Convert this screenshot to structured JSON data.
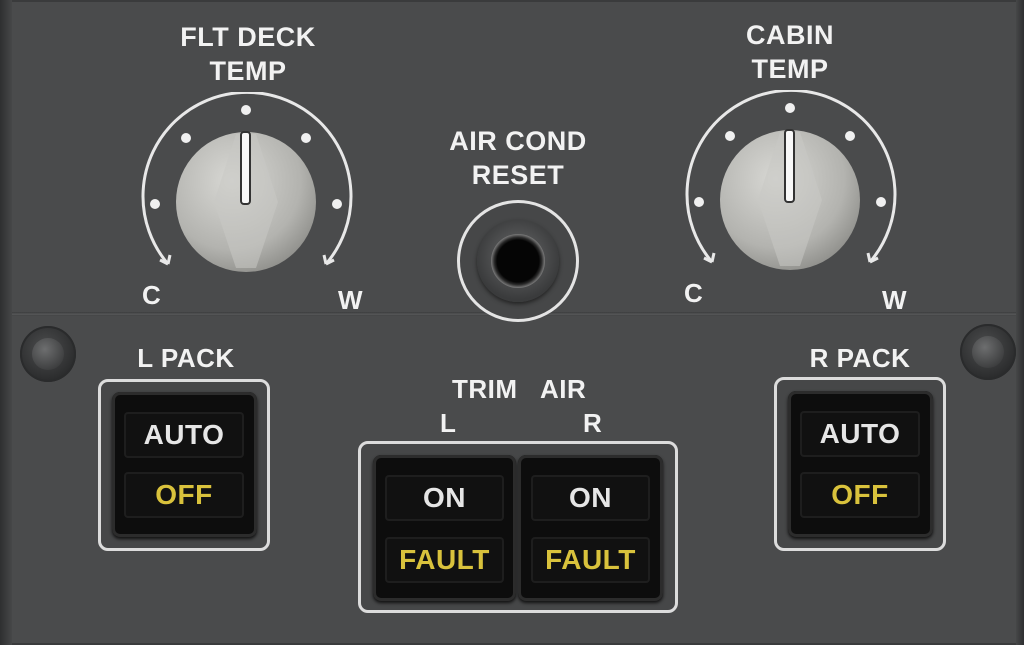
{
  "flt_deck_temp": {
    "label_line1": "FLT DECK",
    "label_line2": "TEMP",
    "cold_label": "C",
    "warm_label": "W"
  },
  "cabin_temp": {
    "label_line1": "CABIN",
    "label_line2": "TEMP",
    "cold_label": "C",
    "warm_label": "W"
  },
  "air_cond_reset": {
    "label_line1": "AIR COND",
    "label_line2": "RESET"
  },
  "l_pack": {
    "label": "L PACK",
    "upper_legend": "AUTO",
    "lower_legend": "OFF"
  },
  "r_pack": {
    "label": "R PACK",
    "upper_legend": "AUTO",
    "lower_legend": "OFF"
  },
  "trim_air": {
    "label_trim": "TRIM",
    "label_air": "AIR",
    "left_label": "L",
    "right_label": "R",
    "left_switch": {
      "upper_legend": "ON",
      "lower_legend": "FAULT"
    },
    "right_switch": {
      "upper_legend": "ON",
      "lower_legend": "FAULT"
    }
  },
  "colors": {
    "panel": "#4a4b4c",
    "legend_white": "#e6e6e6",
    "legend_amber": "#d9c23c",
    "label_white": "#f2f2f2"
  }
}
